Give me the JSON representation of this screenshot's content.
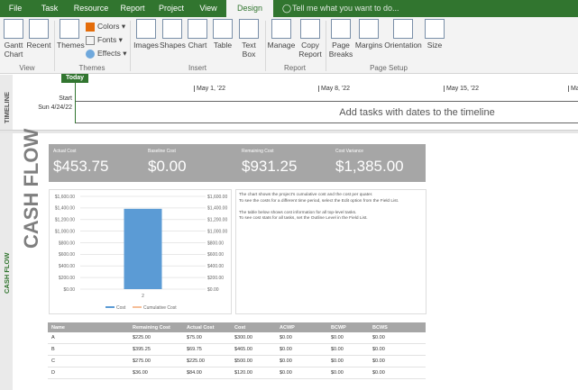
{
  "tabs": [
    {
      "label": "File"
    },
    {
      "label": "Task"
    },
    {
      "label": "Resource"
    },
    {
      "label": "Report"
    },
    {
      "label": "Project"
    },
    {
      "label": "View"
    },
    {
      "label": "Design",
      "active": true
    }
  ],
  "tell_me": "Tell me what you want to do...",
  "ribbon": {
    "groups": [
      {
        "label": "View"
      },
      {
        "label": "Themes"
      },
      {
        "label": "Insert"
      },
      {
        "label": "Report"
      },
      {
        "label": "Page Setup"
      }
    ],
    "buttons": {
      "gantt": "Gantt Chart",
      "recent": "Recent",
      "themes": "Themes",
      "colors": "Colors",
      "fonts": "Fonts",
      "effects": "Effects",
      "images": "Images",
      "shapes": "Shapes",
      "chart": "Chart",
      "table": "Table",
      "textbox": "Text Box",
      "manage": "Manage",
      "copy": "Copy Report",
      "breaks": "Page Breaks",
      "margins": "Margins",
      "orientation": "Orientation",
      "size": "Size"
    }
  },
  "timeline": {
    "side_label": "TIMELINE",
    "today": "Today",
    "start_label": "Start",
    "start_date": "Sun 4/24/22",
    "ticks": [
      "May 1, '22",
      "May 8, '22",
      "May 15, '22",
      "Ma"
    ],
    "placeholder": "Add tasks with dates to the timeline"
  },
  "report": {
    "side_label": "CASH FLOW",
    "title": "CASH FLOW",
    "kpis": [
      {
        "label": "Actual Cost",
        "value": "$453.75"
      },
      {
        "label": "Baseline Cost",
        "value": "$0.00"
      },
      {
        "label": "Remaining Cost",
        "value": "$931.25"
      },
      {
        "label": "Cost Variance",
        "value": "$1,385.00"
      }
    ],
    "note": [
      "The chart shows the project's cumulative cost and the cost per quater.",
      "To see the costs for a different time period, select the Edit option from the Field List.",
      "",
      "The table below shows cost information for all top-level tasks.",
      "To see cost stats for all tasks, set the Outline Level in the Field List."
    ],
    "table": {
      "headers": [
        "Name",
        "Remaining Cost",
        "Actual Cost",
        "Cost",
        "ACWP",
        "BCWP",
        "BCWS"
      ],
      "rows": [
        [
          "A",
          "$225.00",
          "$75.00",
          "$300.00",
          "$0.00",
          "$0.00",
          "$0.00"
        ],
        [
          "B",
          "$395.25",
          "$69.75",
          "$465.00",
          "$0.00",
          "$0.00",
          "$0.00"
        ],
        [
          "C",
          "$275.00",
          "$225.00",
          "$500.00",
          "$0.00",
          "$0.00",
          "$0.00"
        ],
        [
          "D",
          "$36.00",
          "$84.00",
          "$120.00",
          "$0.00",
          "$0.00",
          "$0.00"
        ]
      ]
    }
  },
  "chart_data": {
    "type": "bar",
    "categories": [
      "2"
    ],
    "series": [
      {
        "name": "Cost",
        "values": [
          1385
        ],
        "color": "#5b9bd5"
      },
      {
        "name": "Cumulative Cost",
        "values": [],
        "color": "#ed7d31"
      }
    ],
    "ylim": [
      0,
      1600
    ],
    "y_ticks": [
      "$0.00",
      "$200.00",
      "$400.00",
      "$600.00",
      "$800.00",
      "$1,000.00",
      "$1,200.00",
      "$1,400.00",
      "$1,600.00"
    ],
    "y2_ticks": [
      "$0.00",
      "$200.00",
      "$400.00",
      "$600.00",
      "$800.00",
      "$1,000.00",
      "$1,200.00",
      "$1,400.00",
      "$1,600.00"
    ],
    "grid": true,
    "legend": "bottom"
  }
}
